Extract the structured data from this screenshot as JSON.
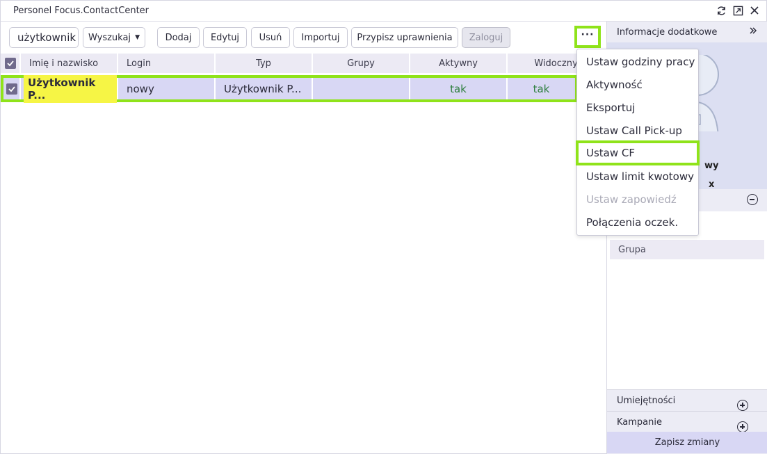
{
  "window": {
    "title": "Personel Focus.ContactCenter"
  },
  "toolbar": {
    "search_value": "użytkownik",
    "search_type": "Wyszukaj",
    "add": "Dodaj",
    "edit": "Edytuj",
    "delete": "Usuń",
    "import": "Importuj",
    "assign_permissions": "Przypisz uprawnienia",
    "login": "Zaloguj",
    "more": "···"
  },
  "table": {
    "columns": [
      "Imię i nazwisko",
      "Login",
      "Typ",
      "Grupy",
      "Aktywny",
      "Widoczny"
    ],
    "rows": [
      {
        "name": "Użytkownik P...",
        "login": "nowy",
        "type": "Użytkownik P...",
        "groups": "",
        "active": "tak",
        "visible": "tak"
      }
    ]
  },
  "context_menu": {
    "items": [
      {
        "label": "Ustaw godziny pracy",
        "disabled": false
      },
      {
        "label": "Aktywność",
        "disabled": false
      },
      {
        "label": "Eksportuj",
        "disabled": false
      },
      {
        "label": "Ustaw Call Pick-up",
        "disabled": false
      },
      {
        "label": "Ustaw CF",
        "disabled": false,
        "highlighted": true
      },
      {
        "label": "Ustaw limit kwotowy",
        "disabled": false
      },
      {
        "label": "Ustaw zapowiedź",
        "disabled": true
      },
      {
        "label": "Połączenia oczek.",
        "disabled": false
      }
    ]
  },
  "right_panel": {
    "title": "Informacje dodatkowe",
    "info_line1": "wy",
    "info_line2": "x",
    "groups_header": "Grupa",
    "skills": "Umiejętności",
    "campaigns": "Kampanie",
    "save": "Zapisz zmiany"
  },
  "colors": {
    "highlight_outline": "#8fe31a",
    "selected_row": "#d8d7f4",
    "name_highlight": "#f6f545",
    "yes_text": "#2f7f3f"
  }
}
